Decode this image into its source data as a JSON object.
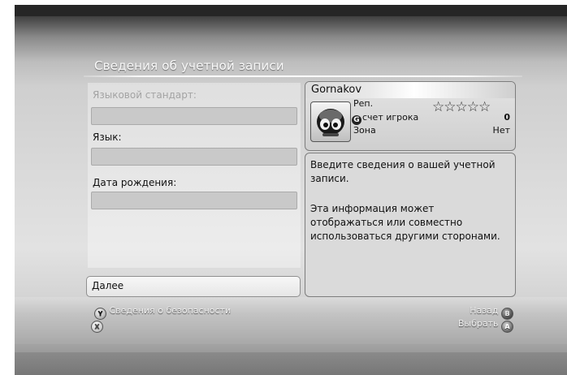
{
  "header": {
    "title": "Сведения об учетной записи"
  },
  "form": {
    "locale_label": "Языковой стандарт:",
    "language_label": "Язык:",
    "birthdate_label": "Дата рождения:",
    "locale_value": "",
    "language_value": "",
    "birthdate_value": "",
    "next_label": "Далее"
  },
  "gamercard": {
    "gamertag": "Gornakov",
    "rep_label": "Реп.",
    "rep_stars": 0,
    "rep_stars_max": 5,
    "score_icon": "G",
    "score_label": "счет игрока",
    "score_value": "0",
    "zone_label": "Зона",
    "zone_value": "Нет"
  },
  "info": {
    "paragraph1": "Введите сведения о вашей учетной записи.",
    "paragraph2": "Эта информация может отображаться или совместно использоваться другими сторонами."
  },
  "footer": {
    "security_button_glyph": "Y",
    "security_label": "Сведения о безопасности",
    "x_button_glyph": "X",
    "back_label": "Назад",
    "back_button_glyph": "B",
    "select_label": "Выбрать",
    "select_button_glyph": "A"
  },
  "colors": {
    "accent": "#ffffff",
    "panel": "#dadada",
    "background": "#cfcfcf"
  }
}
